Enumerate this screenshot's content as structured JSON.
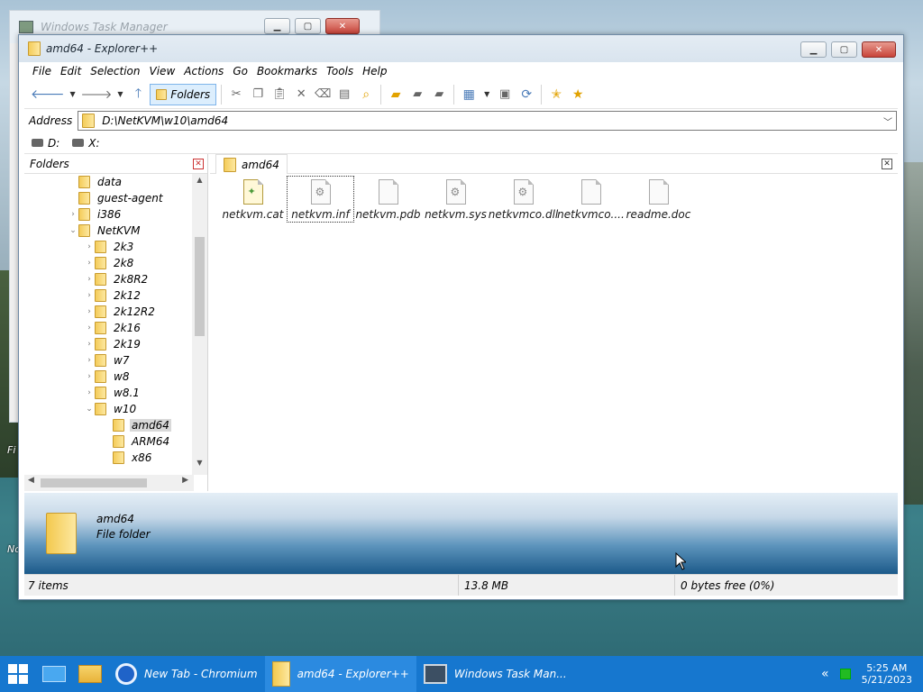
{
  "desktop": {
    "labels": [
      "Fi",
      "Nc"
    ]
  },
  "task_manager": {
    "title": "Windows Task Manager"
  },
  "explorer": {
    "title": "amd64 - Explorer++",
    "menu": [
      "File",
      "Edit",
      "Selection",
      "View",
      "Actions",
      "Go",
      "Bookmarks",
      "Tools",
      "Help"
    ],
    "toolbar": {
      "folders_label": "Folders"
    },
    "address": {
      "label": "Address",
      "value": "D:\\NetKVM\\w10\\amd64"
    },
    "drives": [
      "D:",
      "X:"
    ],
    "folders_pane": {
      "title": "Folders",
      "tree": [
        {
          "label": "data",
          "depth": 0,
          "expander": ""
        },
        {
          "label": "guest-agent",
          "depth": 0,
          "expander": ""
        },
        {
          "label": "i386",
          "depth": 0,
          "expander": ">"
        },
        {
          "label": "NetKVM",
          "depth": 0,
          "expander": "v"
        },
        {
          "label": "2k3",
          "depth": 1,
          "expander": ">"
        },
        {
          "label": "2k8",
          "depth": 1,
          "expander": ">"
        },
        {
          "label": "2k8R2",
          "depth": 1,
          "expander": ">"
        },
        {
          "label": "2k12",
          "depth": 1,
          "expander": ">"
        },
        {
          "label": "2k12R2",
          "depth": 1,
          "expander": ">"
        },
        {
          "label": "2k16",
          "depth": 1,
          "expander": ">"
        },
        {
          "label": "2k19",
          "depth": 1,
          "expander": ">"
        },
        {
          "label": "w7",
          "depth": 1,
          "expander": ">"
        },
        {
          "label": "w8",
          "depth": 1,
          "expander": ">"
        },
        {
          "label": "w8.1",
          "depth": 1,
          "expander": ">"
        },
        {
          "label": "w10",
          "depth": 1,
          "expander": "v"
        },
        {
          "label": "amd64",
          "depth": 2,
          "expander": "",
          "selected": true
        },
        {
          "label": "ARM64",
          "depth": 2,
          "expander": ""
        },
        {
          "label": "x86",
          "depth": 2,
          "expander": ""
        }
      ]
    },
    "tab": {
      "label": "amd64"
    },
    "files": [
      {
        "name": "netkvm.cat",
        "icon": "cert"
      },
      {
        "name": "netkvm.inf",
        "icon": "gear",
        "selected": true
      },
      {
        "name": "netkvm.pdb",
        "icon": "blank"
      },
      {
        "name": "netkvm.sys",
        "icon": "gear"
      },
      {
        "name": "netkvmco.dll",
        "icon": "gear"
      },
      {
        "name": "netkvmco....",
        "icon": "blank"
      },
      {
        "name": "readme.doc",
        "icon": "blank"
      }
    ],
    "preview": {
      "name": "amd64",
      "type": "File folder"
    },
    "status": {
      "items": "7 items",
      "size": "13.8 MB",
      "free": "0 bytes free (0%)"
    }
  },
  "taskbar": {
    "apps": [
      {
        "label": "New Tab - Chromium",
        "icon": "chromium-icon"
      },
      {
        "label": "amd64 - Explorer++",
        "icon": "folder-icon",
        "active": true
      },
      {
        "label": "Windows Task Man...",
        "icon": "task-manager-icon"
      }
    ],
    "time": "5:25 AM",
    "date": "5/21/2023"
  },
  "colors": {
    "taskbar": "#1677cf",
    "selection": "#d9d9d9",
    "accent": "#7eb4ea"
  }
}
